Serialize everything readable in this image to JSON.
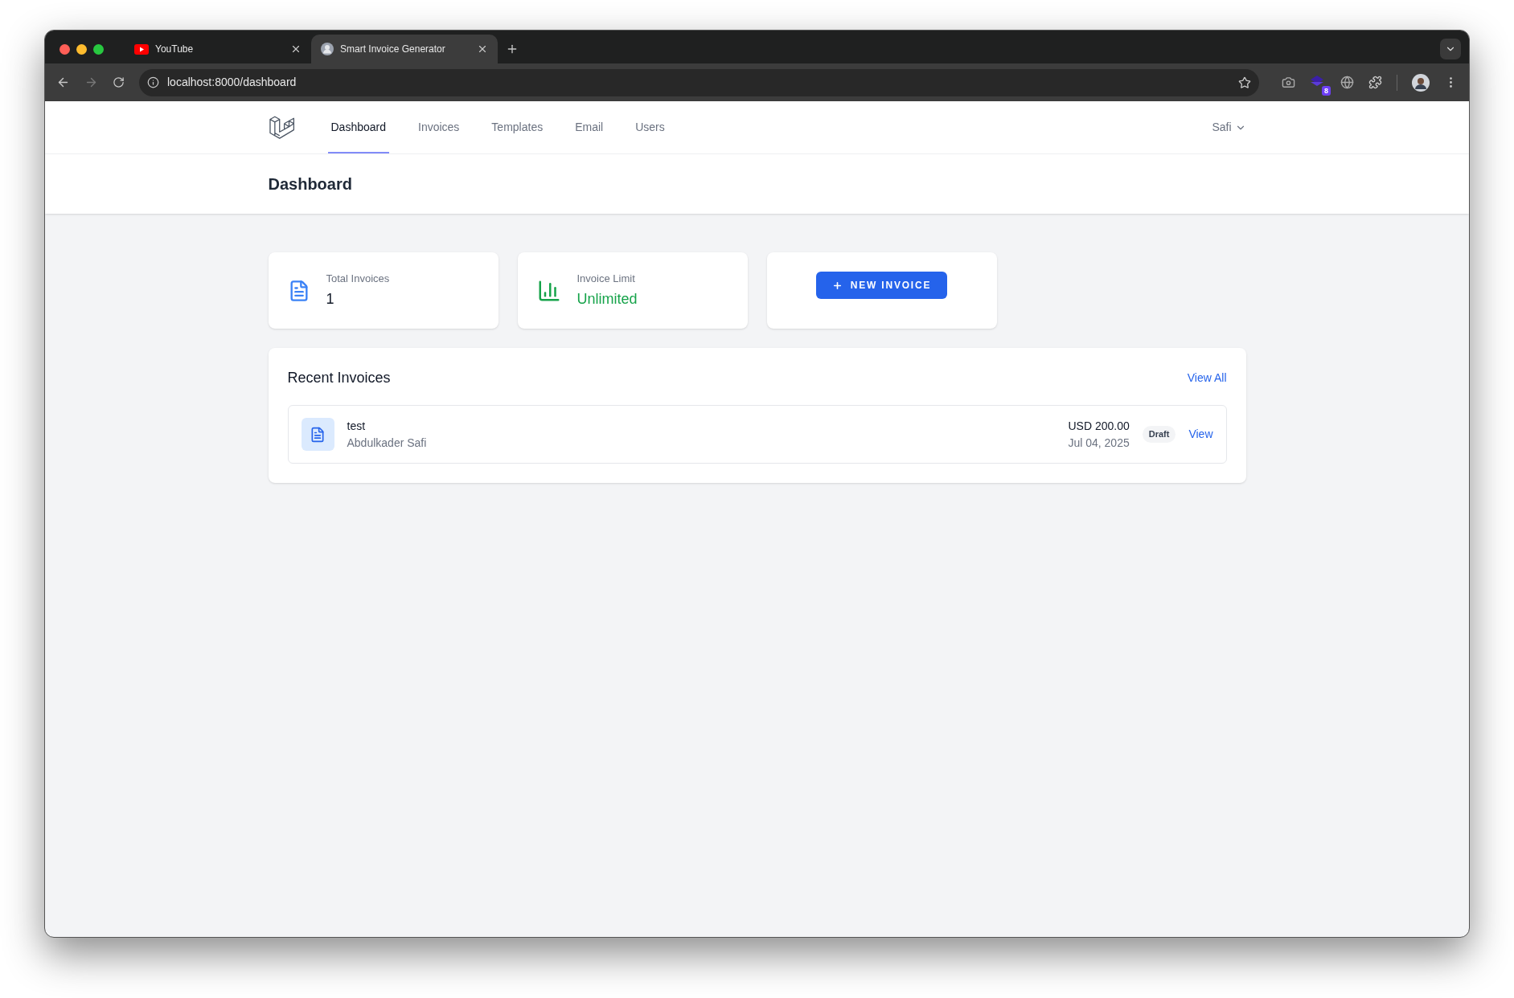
{
  "browser": {
    "tabs": [
      {
        "title": "YouTube",
        "selected": false,
        "kind": "video"
      },
      {
        "title": "Smart Invoice Generator",
        "selected": true,
        "kind": "avatar"
      }
    ],
    "address": "localhost:8000/dashboard",
    "extension_badge": "8"
  },
  "nav": {
    "items": [
      {
        "label": "Dashboard",
        "selected": true
      },
      {
        "label": "Invoices",
        "selected": false
      },
      {
        "label": "Templates",
        "selected": false
      },
      {
        "label": "Email",
        "selected": false
      },
      {
        "label": "Users",
        "selected": false
      }
    ],
    "user": "Safi"
  },
  "header": {
    "title": "Dashboard"
  },
  "stats": [
    {
      "kind": "document",
      "label": "Total Invoices",
      "value": "1"
    },
    {
      "kind": "chart",
      "label": "Invoice Limit",
      "value": "Unlimited"
    }
  ],
  "new_invoice_button": "NEW INVOICE",
  "recent": {
    "title": "Recent Invoices",
    "view_all": "View All",
    "rows": [
      {
        "title": "test",
        "client": "Abdulkader Safi",
        "amount": "USD 200.00",
        "date": "Jul 04, 2025",
        "status": "Draft",
        "action": "View"
      }
    ]
  }
}
